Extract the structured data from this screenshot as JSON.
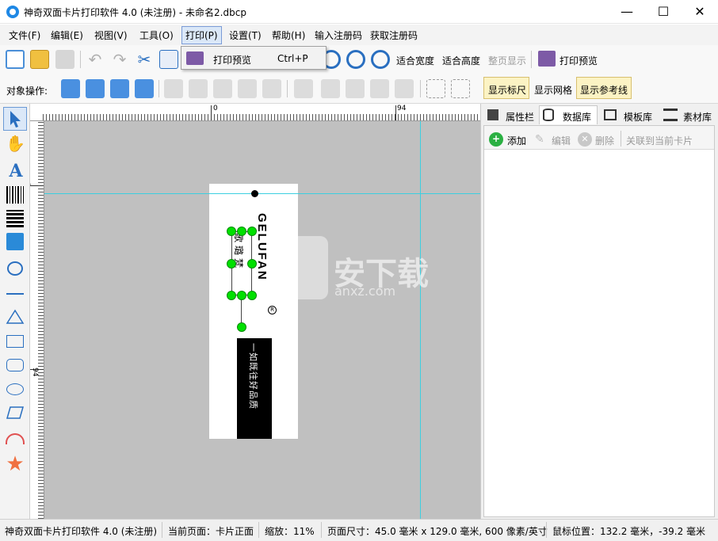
{
  "window": {
    "title": "神奇双面卡片打印软件 4.0 (未注册) - 未命名2.dbcp",
    "minimize": "—",
    "maximize": "☐",
    "close": "✕"
  },
  "menu": [
    "文件(F)",
    "编辑(E)",
    "视图(V)",
    "工具(O)",
    "打印(P)",
    "设置(T)",
    "帮助(H)",
    "输入注册码",
    "获取注册码"
  ],
  "print_menu": {
    "item_label": "打印预览",
    "shortcut": "Ctrl+P"
  },
  "toolbar1": {
    "fit_width": "适合宽度",
    "fit_height": "适合高度",
    "fit_page": "整页显示",
    "print_preview": "打印预览"
  },
  "toolbar2": {
    "object_ops_label": "对象操作:",
    "show_ruler": "显示标尺",
    "show_grid": "显示网格",
    "show_guides": "显示参考线"
  },
  "ruler": {
    "h_zero": "0",
    "h_94": "94",
    "v_zero": "0",
    "v_94": "94"
  },
  "card": {
    "brand_vertical": "GELUFAN",
    "chinese_vertical": "歌璐梵",
    "registered": "R",
    "slogan": "一如既往好品质"
  },
  "watermark": {
    "main": "安下载",
    "sub": "anxz.com"
  },
  "right_panel": {
    "tabs": [
      "属性栏",
      "数据库",
      "模板库",
      "素材库"
    ],
    "actions": {
      "add": "添加",
      "edit": "编辑",
      "delete": "删除",
      "link": "关联到当前卡片"
    }
  },
  "status": {
    "app": "神奇双面卡片打印软件 4.0 (未注册)",
    "current_page": "当前页面：卡片正面",
    "zoom": "缩放：11%",
    "page_size": "页面尺寸：45.0 毫米 x 129.0 毫米, 600 像素/英寸",
    "mouse_pos": "鼠标位置：132.2 毫米，-39.2 毫米"
  },
  "colors": {
    "accent": "#1e88e5",
    "handle_green": "#00e000",
    "guide_cyan": "#3ccfe0",
    "canvas_gray": "#c0c0c0",
    "highlight_yellow": "#fcf3c4"
  }
}
